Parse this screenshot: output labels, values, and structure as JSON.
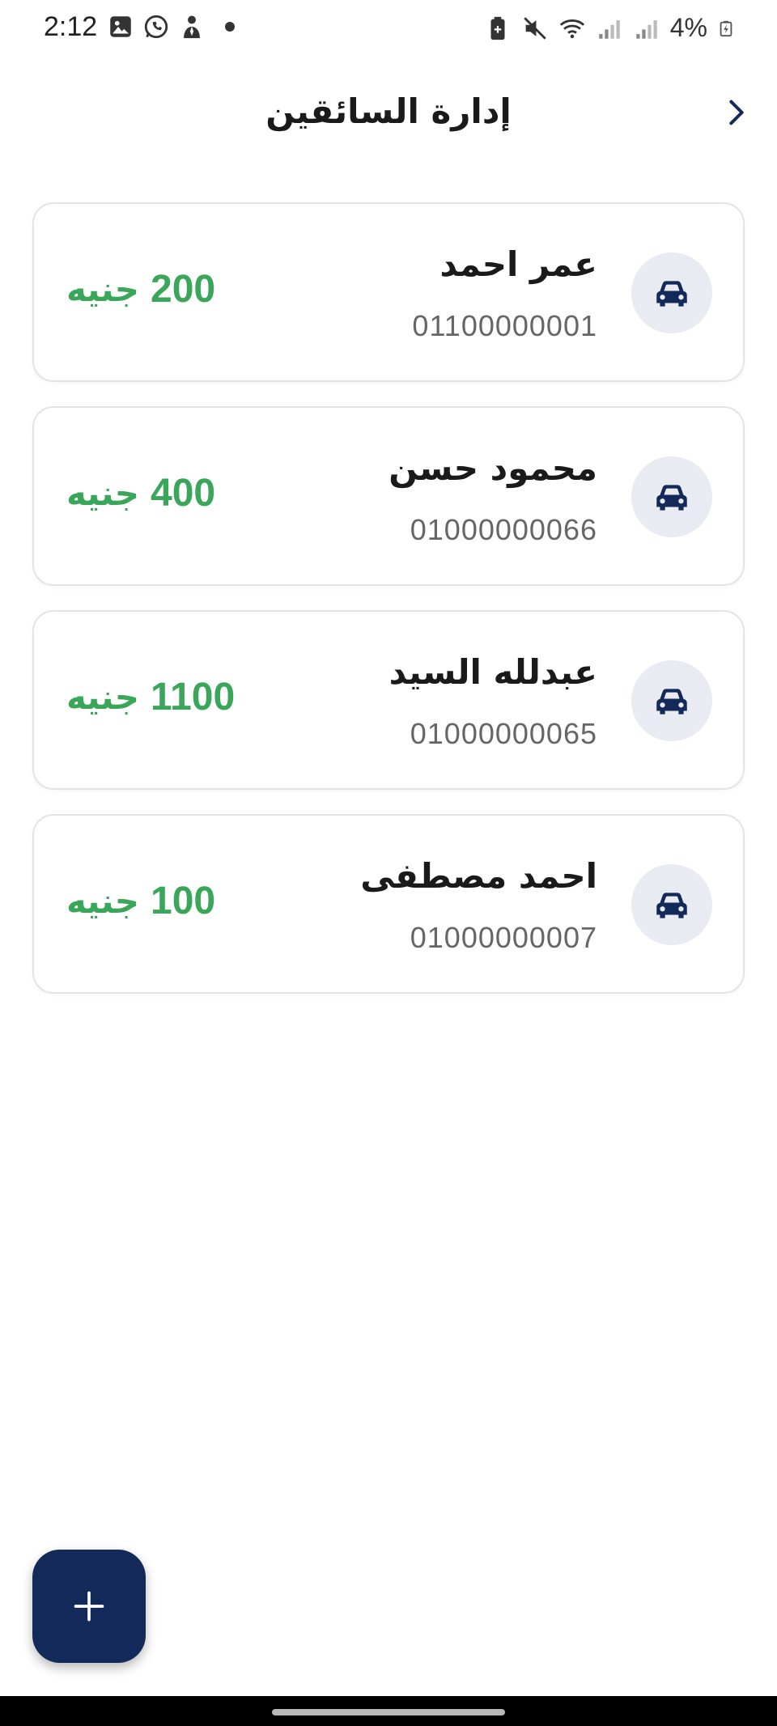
{
  "status_bar": {
    "time": "2:12",
    "battery": "4%",
    "left_icons": [
      "gallery-icon",
      "whatsapp-icon",
      "user-tie-icon",
      "notification-dot-icon"
    ],
    "right_icons": [
      "battery-saver-icon",
      "mute-icon",
      "wifi-icon",
      "signal-icon",
      "signal-icon",
      "battery-icon"
    ]
  },
  "header": {
    "title": "إدارة السائقين",
    "back_icon": "chevron-right-icon"
  },
  "drivers": [
    {
      "name": "عمر احمد",
      "phone": "01100000001",
      "amount": "200",
      "currency": "جنيه"
    },
    {
      "name": "محمود حسن",
      "phone": "01000000066",
      "amount": "400",
      "currency": "جنيه"
    },
    {
      "name": "عبدلله السيد",
      "phone": "01000000065",
      "amount": "1100",
      "currency": "جنيه"
    },
    {
      "name": "احمد مصطفى",
      "phone": "01000000007",
      "amount": "100",
      "currency": "جنيه"
    }
  ],
  "fab": {
    "icon": "plus-icon"
  },
  "colors": {
    "primary": "#13295a",
    "balance": "#3aa65a",
    "avatar_bg": "#e8ecf2",
    "card_border": "#e2e4e8"
  }
}
